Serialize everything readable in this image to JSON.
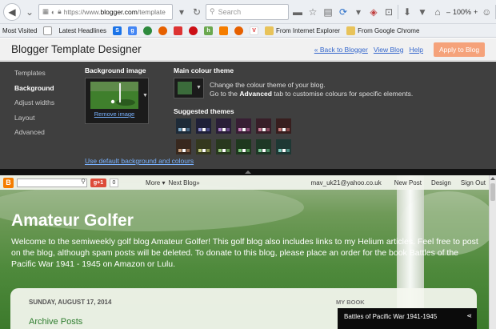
{
  "browser": {
    "url_prefix": "https://www.",
    "url_domain": "blogger.com",
    "url_suffix": "/template",
    "search_placeholder": "Search",
    "zoom": "100%",
    "zoom_minus": "–",
    "zoom_plus": "+"
  },
  "bookmarks": {
    "most_visited": "Most Visited",
    "latest_headlines": "Latest Headlines",
    "from_ie": "From Internet Explorer",
    "from_chrome": "From Google Chrome"
  },
  "designer": {
    "title": "Blogger Template Designer",
    "back_link": "« Back to Blogger",
    "view_blog": "View Blog",
    "help": "Help",
    "apply": "Apply to Blog",
    "nav": [
      "Templates",
      "Background",
      "Adjust widths",
      "Layout",
      "Advanced"
    ],
    "active_nav_index": 1,
    "bg_image_label": "Background image",
    "remove_image": "Remove image",
    "main_theme_label": "Main colour theme",
    "theme_desc_line1": "Change the colour theme of your blog.",
    "theme_desc_line2_pre": "Go to the ",
    "theme_desc_line2_bold": "Advanced",
    "theme_desc_line2_post": " tab to customise colours for specific elements.",
    "suggested_label": "Suggested themes",
    "default_link": "Use default background and colours",
    "main_theme_color": "#3b6b3b",
    "suggested_themes": [
      {
        "bg": "#1e2b38",
        "chips": [
          "#7da8c8",
          "#ffffff",
          "#4a6b88"
        ]
      },
      {
        "bg": "#1f2038",
        "chips": [
          "#8a8acc",
          "#ffffff",
          "#4c4c88"
        ]
      },
      {
        "bg": "#2a1e38",
        "chips": [
          "#a87cc8",
          "#ffffff",
          "#6a4a88"
        ]
      },
      {
        "bg": "#381e34",
        "chips": [
          "#c87cb8",
          "#ffffff",
          "#884a78"
        ]
      },
      {
        "bg": "#381e28",
        "chips": [
          "#c87c98",
          "#ffffff",
          "#884a60"
        ]
      },
      {
        "bg": "#381e1e",
        "chips": [
          "#c87c7c",
          "#ffffff",
          "#884a4a"
        ]
      },
      {
        "bg": "#38281e",
        "chips": [
          "#c8a07c",
          "#ffffff",
          "#88644a"
        ]
      },
      {
        "bg": "#34381e",
        "chips": [
          "#c0c87c",
          "#ffffff",
          "#80884a"
        ]
      },
      {
        "bg": "#28381e",
        "chips": [
          "#98c87c",
          "#ffffff",
          "#5a884a"
        ]
      },
      {
        "bg": "#1e381e",
        "chips": [
          "#7cc87c",
          "#ffffff",
          "#4a884a"
        ]
      },
      {
        "bg": "#1e3826",
        "chips": [
          "#7cc894",
          "#ffffff",
          "#4a8860"
        ]
      },
      {
        "bg": "#1e3834",
        "chips": [
          "#7cc8bc",
          "#ffffff",
          "#4a887e"
        ]
      }
    ]
  },
  "blog": {
    "gplus": "g+1",
    "gplus_count": "0",
    "more": "More ▾",
    "next_blog": "Next Blog»",
    "email": "mav_uk21@yahoo.co.uk",
    "new_post": "New Post",
    "design": "Design",
    "sign_out": "Sign Out",
    "title": "Amateur Golfer",
    "description": "Welcome to the semiweekly golf blog Amateur Golfer! This golf blog also includes links to my Helium articles. Feel free to post on the blog, although spam posts will be deleted. To donate to this blog, please place an order for the book Battles of the Pacific War 1941 - 1945 on Amazon or Lulu.",
    "post_date": "SUNDAY, AUGUST 17, 2014",
    "post_title": "Archive Posts",
    "sidebar_title": "MY BOOK",
    "book_embed_title": "Battles of Pacific War 1941-1945"
  }
}
